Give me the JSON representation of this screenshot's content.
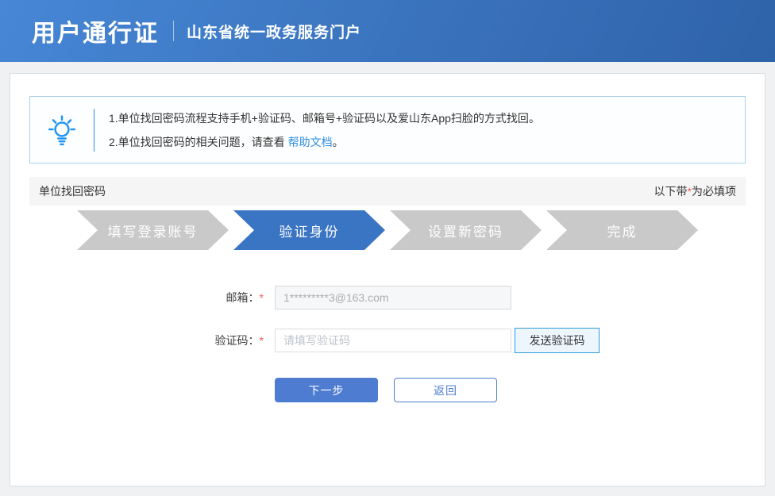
{
  "header": {
    "title": "用户通行证",
    "subtitle": "山东省统一政务服务门户"
  },
  "notice": {
    "icon": "lightbulb-icon",
    "line1": "1.单位找回密码流程支持手机+验证码、邮箱号+验证码以及爱山东App扫脸的方式找回。",
    "line2_prefix": "2.单位找回密码的相关问题，请查看 ",
    "line2_link": "帮助文档",
    "line2_suffix": "。"
  },
  "section": {
    "title": "单位找回密码",
    "required_prefix": "以下带",
    "required_star": "*",
    "required_suffix": "为必填项"
  },
  "steps": [
    {
      "label": "填写登录账号",
      "active": false
    },
    {
      "label": "验证身份",
      "active": true
    },
    {
      "label": "设置新密码",
      "active": false
    },
    {
      "label": "完成",
      "active": false
    }
  ],
  "form": {
    "email": {
      "label": "邮箱：",
      "required_star": "*",
      "value": "1*********3@163.com"
    },
    "code": {
      "label": "验证码：",
      "required_star": "*",
      "placeholder": "请填写验证码",
      "send_button_label": "发送验证码"
    },
    "next_button_label": "下一步",
    "back_button_label": "返回"
  },
  "colors": {
    "header_gradient_start": "#4687d6",
    "header_gradient_end": "#2e63a9",
    "step_active_blue": "#3a75c4",
    "step_gray": "#c9c9c9",
    "link_blue": "#2e8ee6",
    "notice_border_blue": "#a9d1ec",
    "button_blue": "#4d7cd1",
    "send_button_border": "#2f9bdb",
    "send_button_bg": "#edf6fd",
    "required_red": "#f25a5a",
    "section_bar_bg": "#f5f5f5"
  }
}
